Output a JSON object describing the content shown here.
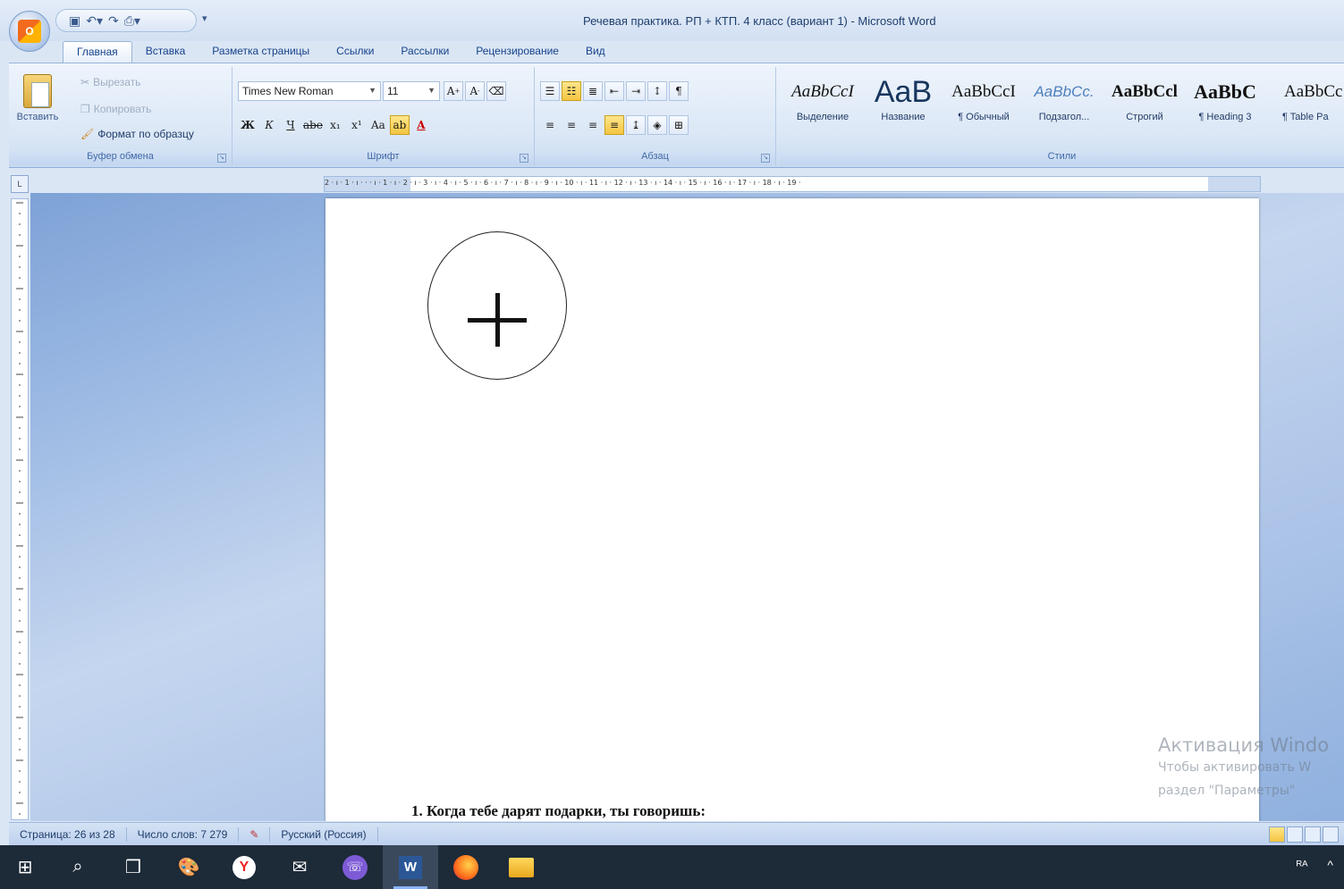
{
  "window": {
    "title": "Речевая практика. РП + КТП. 4 класс (вариант 1) - Microsoft Word"
  },
  "office_button": {
    "icon": "office-logo-icon"
  },
  "quick_access": {
    "save_icon": "save-icon",
    "undo_icon": "undo-icon",
    "redo_icon": "redo-icon",
    "print_icon": "print-icon"
  },
  "tabs": [
    {
      "label": "Главная",
      "active": true
    },
    {
      "label": "Вставка"
    },
    {
      "label": "Разметка страницы"
    },
    {
      "label": "Ссылки"
    },
    {
      "label": "Рассылки"
    },
    {
      "label": "Рецензирование"
    },
    {
      "label": "Вид"
    }
  ],
  "clipboard": {
    "paste": "Вставить",
    "cut": "Вырезать",
    "copy": "Копировать",
    "format_painter": "Формат по образцу",
    "group_label": "Буфер обмена"
  },
  "font": {
    "family": "Times New Roman",
    "size": "11",
    "group_label": "Шрифт",
    "bold": "Ж",
    "italic": "К",
    "underline": "Ч",
    "strike": "abe",
    "subscript": "x₁",
    "superscript": "x¹",
    "case": "Aa",
    "color": "A"
  },
  "paragraph": {
    "group_label": "Абзац"
  },
  "styles": {
    "group_label": "Стили",
    "items": [
      {
        "sample": "AaBbCcI",
        "name": "Выделение"
      },
      {
        "sample": "AaB",
        "name": "Название"
      },
      {
        "sample": "AaBbCcI",
        "name": "¶ Обычный"
      },
      {
        "sample": "AaBbCc.",
        "name": "Подзагол..."
      },
      {
        "sample": "AaBbCcl",
        "name": "Строгий"
      },
      {
        "sample": "AaBbC",
        "name": "¶ Heading 3"
      },
      {
        "sample": "AaBbCc",
        "name": "¶ Table Pa"
      }
    ]
  },
  "ruler": {
    "corner": "L",
    "ticks": "2 · ı · 1 · ı · · · ı · 1 · ı · 2 · ı · 3 · ı · 4 · ı · 5 · ı · 6 · ı · 7 · ı · 8 · ı · 9 · ı · 10 · ı · 11 · ı · 12 · ı · 13 · ı · 14 · ı · 15 · ı · 16 · ı · 17 · ı · 18 · ı · 19 ·"
  },
  "document": {
    "question": "1. Когда тебе дарят подарки, ты говоришь:"
  },
  "watermark": {
    "line1": "Активация Windo",
    "line2": "Чтобы активировать W",
    "line3": "раздел \"Параметры\""
  },
  "statusbar": {
    "page": "Страница: 26 из 28",
    "words": "Число слов: 7 279",
    "language": "Русский (Россия)"
  },
  "taskbar": {
    "start_icon": "windows-start-icon",
    "search_icon": "search-icon",
    "taskview_icon": "task-view-icon"
  },
  "tray": {
    "lang": "ᴿᴬ",
    "chevron": "^"
  }
}
